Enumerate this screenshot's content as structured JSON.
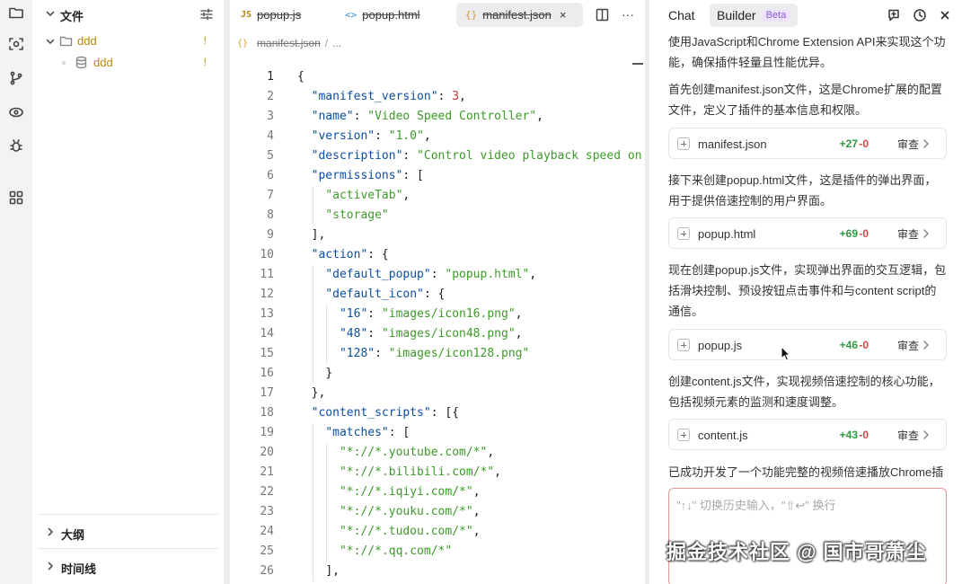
{
  "activity_bar": {
    "items": [
      "explorer-icon",
      "scan-icon",
      "source-control-icon",
      "extensions-icon",
      "debug-icon",
      "apps-icon"
    ]
  },
  "explorer": {
    "title": "文件",
    "tree": [
      {
        "label": "ddd",
        "mark": "!",
        "kind": "folder"
      },
      {
        "label": "ddd",
        "mark": "!",
        "kind": "file"
      }
    ],
    "sections": [
      "大纲",
      "时间线"
    ]
  },
  "editor": {
    "tabs": [
      {
        "icon": "JS",
        "label": "popup.js",
        "active": false
      },
      {
        "icon": "<>",
        "label": "popup.html",
        "active": false
      },
      {
        "icon": "{}",
        "label": "manifest.json",
        "active": true,
        "close": "×"
      }
    ],
    "more": "···",
    "breadcrumb": {
      "icon": "{}",
      "file": "manifest.json",
      "sep": "/",
      "tail": "..."
    },
    "current_line": 1,
    "lines": [
      [
        [
          "{",
          "p"
        ]
      ],
      [
        [
          "  ",
          "w"
        ],
        [
          "\"manifest_version\"",
          "k"
        ],
        [
          ": ",
          "p"
        ],
        [
          "3",
          "n"
        ],
        [
          ",",
          "p"
        ]
      ],
      [
        [
          "  ",
          "w"
        ],
        [
          "\"name\"",
          "k"
        ],
        [
          ": ",
          "p"
        ],
        [
          "\"Video Speed Controller\"",
          "s"
        ],
        [
          ",",
          "p"
        ]
      ],
      [
        [
          "  ",
          "w"
        ],
        [
          "\"version\"",
          "k"
        ],
        [
          ": ",
          "p"
        ],
        [
          "\"1.0\"",
          "s"
        ],
        [
          ",",
          "p"
        ]
      ],
      [
        [
          "  ",
          "w"
        ],
        [
          "\"description\"",
          "k"
        ],
        [
          ": ",
          "p"
        ],
        [
          "\"Control video playback speed on",
          "s"
        ]
      ],
      [
        [
          "  ",
          "w"
        ],
        [
          "\"permissions\"",
          "k"
        ],
        [
          ": [",
          "p"
        ]
      ],
      [
        [
          "    ",
          "w"
        ],
        [
          "\"activeTab\"",
          "s"
        ],
        [
          ",",
          "p"
        ]
      ],
      [
        [
          "    ",
          "w"
        ],
        [
          "\"storage\"",
          "s"
        ]
      ],
      [
        [
          "  ",
          "w"
        ],
        [
          "],",
          "p"
        ]
      ],
      [
        [
          "  ",
          "w"
        ],
        [
          "\"action\"",
          "k"
        ],
        [
          ": {",
          "p"
        ]
      ],
      [
        [
          "    ",
          "w"
        ],
        [
          "\"default_popup\"",
          "k"
        ],
        [
          ": ",
          "p"
        ],
        [
          "\"popup.html\"",
          "s"
        ],
        [
          ",",
          "p"
        ]
      ],
      [
        [
          "    ",
          "w"
        ],
        [
          "\"default_icon\"",
          "k"
        ],
        [
          ": {",
          "p"
        ]
      ],
      [
        [
          "      ",
          "w"
        ],
        [
          "\"16\"",
          "k"
        ],
        [
          ": ",
          "p"
        ],
        [
          "\"images/icon16.png\"",
          "s"
        ],
        [
          ",",
          "p"
        ]
      ],
      [
        [
          "      ",
          "w"
        ],
        [
          "\"48\"",
          "k"
        ],
        [
          ": ",
          "p"
        ],
        [
          "\"images/icon48.png\"",
          "s"
        ],
        [
          ",",
          "p"
        ]
      ],
      [
        [
          "      ",
          "w"
        ],
        [
          "\"128\"",
          "k"
        ],
        [
          ": ",
          "p"
        ],
        [
          "\"images/icon128.png\"",
          "s"
        ]
      ],
      [
        [
          "    ",
          "w"
        ],
        [
          "}",
          "p"
        ]
      ],
      [
        [
          "  ",
          "w"
        ],
        [
          "},",
          "p"
        ]
      ],
      [
        [
          "  ",
          "w"
        ],
        [
          "\"content_scripts\"",
          "k"
        ],
        [
          ": [{",
          "p"
        ]
      ],
      [
        [
          "    ",
          "w"
        ],
        [
          "\"matches\"",
          "k"
        ],
        [
          ": [",
          "p"
        ]
      ],
      [
        [
          "      ",
          "w"
        ],
        [
          "\"*://*.youtube.com/*\"",
          "s"
        ],
        [
          ",",
          "p"
        ]
      ],
      [
        [
          "      ",
          "w"
        ],
        [
          "\"*://*.bilibili.com/*\"",
          "s"
        ],
        [
          ",",
          "p"
        ]
      ],
      [
        [
          "      ",
          "w"
        ],
        [
          "\"*://*.iqiyi.com/*\"",
          "s"
        ],
        [
          ",",
          "p"
        ]
      ],
      [
        [
          "      ",
          "w"
        ],
        [
          "\"*://*.youku.com/*\"",
          "s"
        ],
        [
          ",",
          "p"
        ]
      ],
      [
        [
          "      ",
          "w"
        ],
        [
          "\"*://*.tudou.com/*\"",
          "s"
        ],
        [
          ",",
          "p"
        ]
      ],
      [
        [
          "      ",
          "w"
        ],
        [
          "\"*://*.qq.com/*\"",
          "s"
        ]
      ],
      [
        [
          "    ",
          "w"
        ],
        [
          "],",
          "p"
        ]
      ]
    ],
    "colors": {
      "key": "#0b4fa6",
      "string": "#3e9a2a",
      "number": "#c0392b"
    }
  },
  "panel": {
    "tabs": [
      {
        "label": "Chat",
        "active": false
      },
      {
        "label": "Builder",
        "badge": "Beta",
        "active": true
      }
    ],
    "icons": [
      "new-chat-icon",
      "history-icon",
      "close-icon"
    ],
    "messages": [
      "使用JavaScript和Chrome Extension API来实现这个功能，确保插件轻量且性能优异。",
      "首先创建manifest.json文件，这是Chrome扩展的配置文件，定义了插件的基本信息和权限。",
      "接下来创建popup.html文件，这是插件的弹出界面，用于提供倍速控制的用户界面。",
      "现在创建popup.js文件，实现弹出界面的交互逻辑，包括滑块控制、预设按钮点击事件和与content script的通信。",
      "创建content.js文件，实现视频倍速控制的核心功能，包括视频元素的监测和速度调整。",
      "已成功开发了一个功能完整的视频倍速播放Chrome插"
    ],
    "files": [
      {
        "name": "manifest.json",
        "added": "+27",
        "removed": "-0",
        "action": "审查"
      },
      {
        "name": "popup.html",
        "added": "+69",
        "removed": "-0",
        "action": "审查"
      },
      {
        "name": "popup.js",
        "added": "+46",
        "removed": "-0",
        "action": "审查"
      },
      {
        "name": "content.js",
        "added": "+43",
        "removed": "-0",
        "action": "审查"
      }
    ],
    "input_placeholder": "\"↑↓\" 切换历史输入，\"⇧↩\" 换行",
    "watermark": "掘金技术社区 @ 国市哥萧尘"
  }
}
